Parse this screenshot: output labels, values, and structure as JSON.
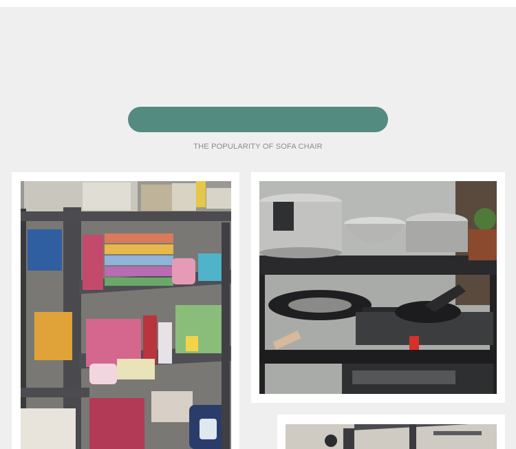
{
  "header": {
    "subtitle": "THE POPULARITY OF SOFA CHAIR"
  },
  "colors": {
    "accent_pill": "#538b80",
    "page_background": "#efeff0",
    "card_background": "#ffffff"
  },
  "gallery": {
    "photos": [
      {
        "subject": "bookshelf-with-books-and-mug"
      },
      {
        "subject": "kitchen-rack-with-pots-and-pans"
      },
      {
        "subject": "metal-shelf-partial"
      }
    ]
  }
}
